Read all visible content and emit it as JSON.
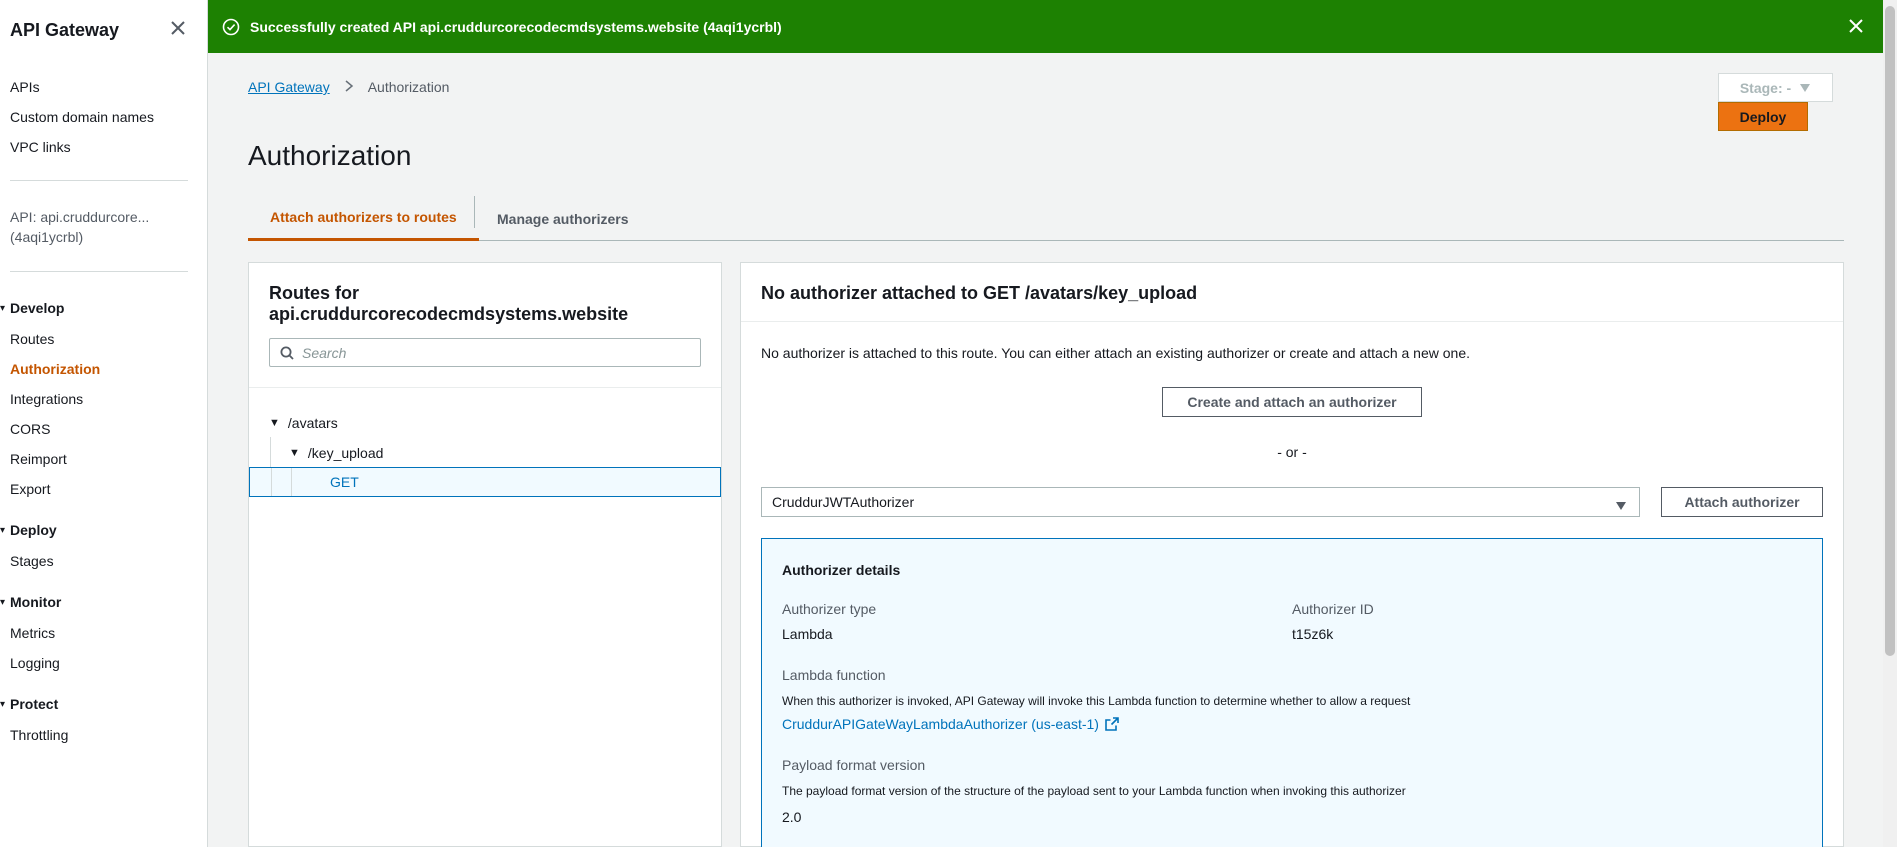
{
  "sidebar": {
    "brand": "API Gateway",
    "top_links": [
      "APIs",
      "Custom domain names",
      "VPC links"
    ],
    "api_name_line1": "API: api.cruddurcore...",
    "api_name_line2": "(4aqi1ycrbl)",
    "sections": {
      "develop": {
        "title": "Develop",
        "items": [
          "Routes",
          "Authorization",
          "Integrations",
          "CORS",
          "Reimport",
          "Export"
        ]
      },
      "deploy": {
        "title": "Deploy",
        "items": [
          "Stages"
        ]
      },
      "monitor": {
        "title": "Monitor",
        "items": [
          "Metrics",
          "Logging"
        ]
      },
      "protect": {
        "title": "Protect",
        "items": [
          "Throttling"
        ]
      }
    }
  },
  "flash": {
    "message": "Successfully created API api.cruddurcorecodecmdsystems.website (4aqi1ycrbl)"
  },
  "breadcrumb": {
    "root": "API Gateway",
    "current": "Authorization"
  },
  "stage": {
    "label": "Stage: -"
  },
  "deploy": {
    "label": "Deploy"
  },
  "page_title": "Authorization",
  "tabs": [
    {
      "label": "Attach authorizers to routes",
      "active": true
    },
    {
      "label": "Manage authorizers",
      "active": false
    }
  ],
  "routes": {
    "title_line1": "Routes for",
    "title_line2": "api.cruddurcorecodecmdsystems.website",
    "search_placeholder": "Search",
    "tree": {
      "level1": "/avatars",
      "level2": "/key_upload",
      "method": "GET"
    }
  },
  "detail": {
    "title": "No authorizer attached to GET /avatars/key_upload",
    "description": "No authorizer is attached to this route. You can either attach an existing authorizer or create and attach a new one.",
    "create_button": "Create and attach an authorizer",
    "or_text": "- or -",
    "selected_authorizer": "CruddurJWTAuthorizer",
    "attach_button": "Attach authorizer",
    "details": {
      "heading": "Authorizer details",
      "type_label": "Authorizer type",
      "type_value": "Lambda",
      "id_label": "Authorizer ID",
      "id_value": "t15z6k",
      "lambda_label": "Lambda function",
      "lambda_help": "When this authorizer is invoked, API Gateway will invoke this Lambda function to determine whether to allow a request",
      "lambda_link": "CruddurAPIGateWayLambdaAuthorizer (us-east-1)",
      "payload_label": "Payload format version",
      "payload_help": "The payload format version of the structure of the payload sent to your Lambda function when invoking this authorizer",
      "payload_value": "2.0"
    }
  },
  "colors": {
    "accent": "#c45500",
    "link": "#0073bb",
    "success": "#1d8102",
    "deploy": "#ec7211"
  }
}
